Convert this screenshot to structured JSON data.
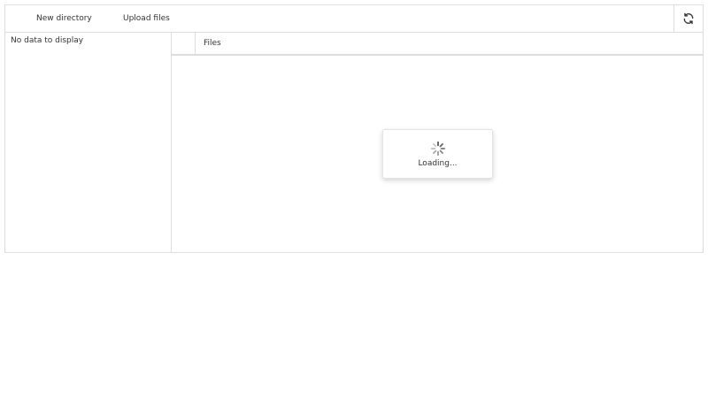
{
  "toolbar": {
    "new_directory_label": "New directory",
    "upload_files_label": "Upload files",
    "refresh_icon": "refresh-icon"
  },
  "tree": {
    "empty_text": "No data to display"
  },
  "files": {
    "column_header": "Files"
  },
  "loading": {
    "text": "Loading...",
    "icon": "spinner-icon"
  },
  "colors": {
    "border": "#dddddd",
    "text": "#333333",
    "spinner": "#555555"
  }
}
